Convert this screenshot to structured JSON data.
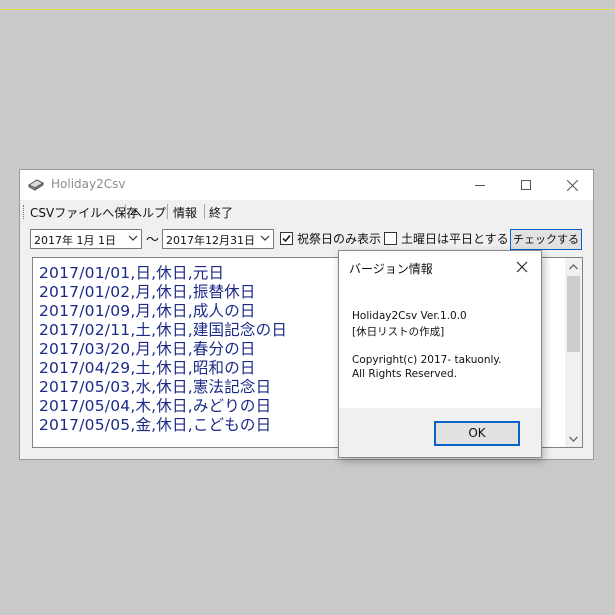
{
  "window": {
    "title": "Holiday2Csv"
  },
  "menu": {
    "items": [
      "CSVファイルへ保存",
      "ヘルプ",
      "情報",
      "終了"
    ]
  },
  "toolbar": {
    "start_date": "2017年  1月  1日",
    "range_sep": "〜",
    "end_date": "2017年12月31日",
    "holidays_only_label": "祝祭日のみ表示",
    "holidays_only_checked": true,
    "saturday_weekday_label": "土曜日は平日とする",
    "saturday_weekday_checked": false,
    "check_button": "チェックする"
  },
  "list": {
    "lines": [
      "2017/01/01,日,休日,元日",
      "2017/01/02,月,休日,振替休日",
      "2017/01/09,月,休日,成人の日",
      "2017/02/11,土,休日,建国記念の日",
      "2017/03/20,月,休日,春分の日",
      "2017/04/29,土,休日,昭和の日",
      "2017/05/03,水,休日,憲法記念日",
      "2017/05/04,木,休日,みどりの日",
      "2017/05/05,金,休日,こどもの日"
    ]
  },
  "dialog": {
    "title": "バージョン情報",
    "line1": "Holiday2Csv Ver.1.0.0",
    "line2": "[休日リストの作成]",
    "line3": "Copyright(c) 2017- takuonly.",
    "line4": "All Rights Reserved.",
    "ok": "OK"
  },
  "colors": {
    "list_text": "#1b2a88",
    "accent": "#0a63c6"
  }
}
